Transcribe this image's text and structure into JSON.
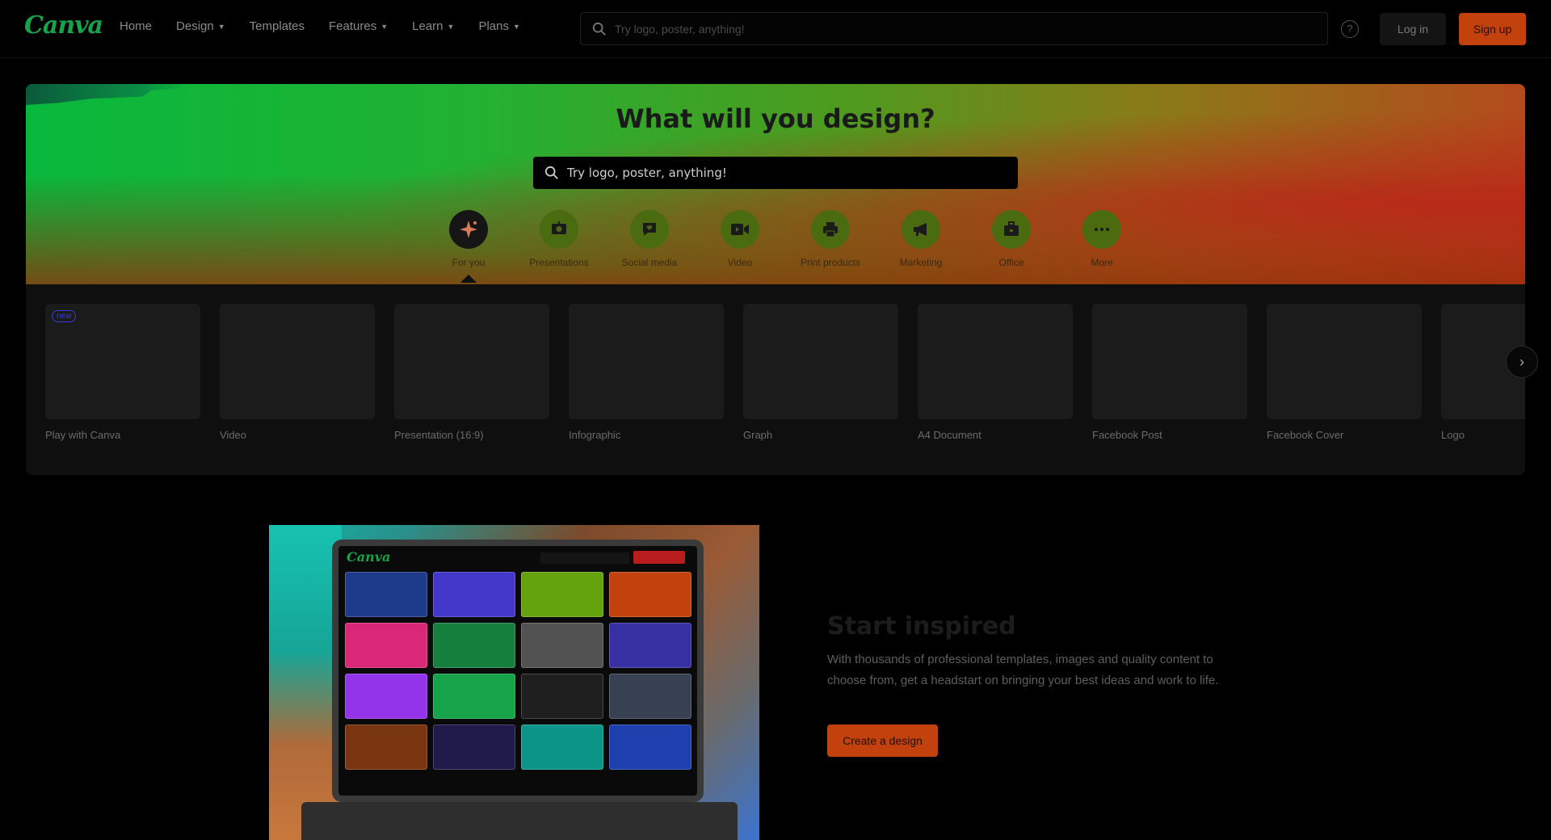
{
  "header": {
    "logo": "Canva",
    "nav": [
      {
        "label": "Home",
        "has_dropdown": false
      },
      {
        "label": "Design",
        "has_dropdown": true
      },
      {
        "label": "Templates",
        "has_dropdown": false
      },
      {
        "label": "Features",
        "has_dropdown": true
      },
      {
        "label": "Learn",
        "has_dropdown": true
      },
      {
        "label": "Plans",
        "has_dropdown": true
      }
    ],
    "search_placeholder": "Try logo, poster, anything!",
    "help_icon": "question-circle-icon",
    "login_label": "Log in",
    "signup_label": "Sign up"
  },
  "hero": {
    "title": "What will you design?",
    "search_placeholder": "Try logo, poster, anything!",
    "categories": [
      {
        "label": "For you",
        "icon": "sparkle-icon",
        "active": true
      },
      {
        "label": "Presentations",
        "icon": "presentation-icon",
        "active": false
      },
      {
        "label": "Social media",
        "icon": "heart-chat-icon",
        "active": false
      },
      {
        "label": "Video",
        "icon": "video-camera-icon",
        "active": false
      },
      {
        "label": "Print products",
        "icon": "printer-icon",
        "active": false
      },
      {
        "label": "Marketing",
        "icon": "megaphone-icon",
        "active": false
      },
      {
        "label": "Office",
        "icon": "briefcase-icon",
        "active": false
      },
      {
        "label": "More",
        "icon": "more-dots-icon",
        "active": false
      }
    ]
  },
  "design_types": {
    "items": [
      {
        "label": "Play with Canva",
        "badge": "new"
      },
      {
        "label": "Video"
      },
      {
        "label": "Presentation (16:9)"
      },
      {
        "label": "Infographic"
      },
      {
        "label": "Graph"
      },
      {
        "label": "A4 Document"
      },
      {
        "label": "Facebook Post"
      },
      {
        "label": "Facebook Cover"
      },
      {
        "label": "Logo"
      }
    ],
    "next_icon": "chevron-right-icon"
  },
  "start_inspired": {
    "title": "Start inspired",
    "description": "With thousands of professional templates, images and quality content to choose from, get a headstart on bringing your best ideas and work to life.",
    "button_label": "Create a design"
  },
  "colors": {
    "brand_green": "#16a34a",
    "accent_orange": "#c2410c",
    "background": "#000000"
  }
}
